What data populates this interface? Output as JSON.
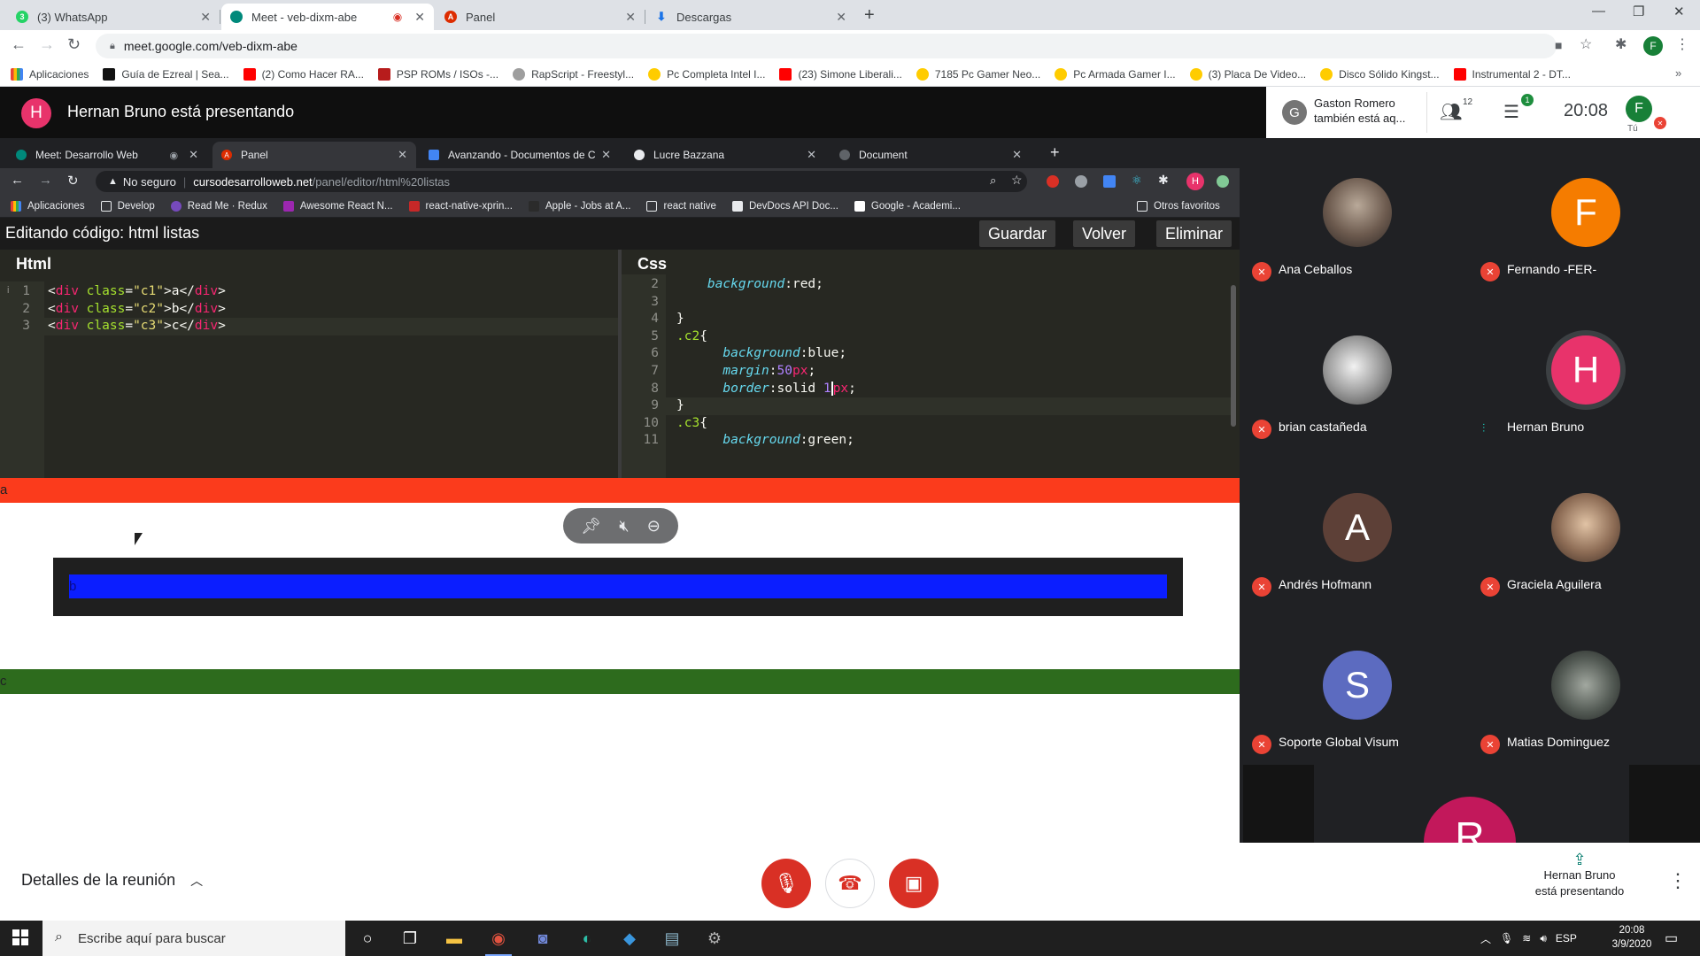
{
  "outer_browser": {
    "tabs": [
      {
        "title": "(3) WhatsApp",
        "color": "#25d366",
        "glyph": "3"
      },
      {
        "title": "Meet - veb-dixm-abe",
        "color": "#00897b",
        "glyph": ""
      },
      {
        "title": "Panel",
        "color": "#dd2c00",
        "glyph": "A"
      },
      {
        "title": "Descargas",
        "color": "#1a73e8",
        "glyph": "⬇"
      }
    ],
    "url": "meet.google.com/veb-dixm-abe",
    "bookmarks": [
      "Aplicaciones",
      "Guía de Ezreal | Sea...",
      "(2) Como Hacer RA...",
      "PSP ROMs / ISOs -...",
      "RapScript - Freestyl...",
      "Pc Completa Intel I...",
      "(23) Simone Liberali...",
      "7185 Pc Gamer Neo...",
      "Pc Armada Gamer I...",
      "(3) Placa De Video...",
      "Disco Sólido Kingst...",
      "Instrumental 2 - DT..."
    ],
    "profile_initial": "F"
  },
  "meet": {
    "presenter_initial": "H",
    "presenting_title": "Hernan Bruno está presentando",
    "also_presenting": {
      "initial": "G",
      "line1": "Gaston Romero",
      "line2": "también está aq..."
    },
    "people_count": "12",
    "chat_badge": "1",
    "time": "20:08",
    "self_initial": "F",
    "self_label": "Tú",
    "meeting_details": "Detalles de la reunión",
    "presenting_info_line1": "Hernan Bruno",
    "presenting_info_line2": "está presentando"
  },
  "inner_browser": {
    "tabs": [
      "Meet: Desarrollo Web",
      "Panel",
      "Avanzando - Documentos de C",
      "Lucre Bazzana",
      "Document"
    ],
    "not_secure": "No seguro",
    "host": "cursodesarrolloweb.net",
    "path": "/panel/editor/html%20listas",
    "profile_initial": "H",
    "bookmarks": [
      "Aplicaciones",
      "Develop",
      "Read Me · Redux",
      "Awesome React N...",
      "react-native-xprin...",
      "Apple - Jobs at A...",
      "react native",
      "DevDocs API Doc...",
      "Google - Academi...",
      "Otros favoritos"
    ]
  },
  "editor": {
    "title": "Editando código: html listas",
    "btn_save": "Guardar",
    "btn_back": "Volver",
    "btn_delete": "Eliminar",
    "html_title": "Html",
    "css_title": "Css",
    "html_line_numbers": [
      "1",
      "2",
      "3"
    ],
    "css_line_numbers": [
      "2",
      "3",
      "4",
      "5",
      "6",
      "7",
      "8",
      "9",
      "10",
      "11"
    ]
  },
  "render": {
    "letter_a": "a",
    "letter_b": "b",
    "letter_c": "c"
  },
  "participants": [
    {
      "name": "Ana Ceballos",
      "initial": "",
      "color": "",
      "muted": true,
      "photo": "photo"
    },
    {
      "name": "Fernando -FER-",
      "initial": "F",
      "color": "#f57c00",
      "muted": true,
      "photo": ""
    },
    {
      "name": "brian castañeda",
      "initial": "",
      "color": "",
      "muted": true,
      "photo": "photo2"
    },
    {
      "name": "Hernan Bruno",
      "initial": "H",
      "color": "#e8336b",
      "muted": false,
      "photo": ""
    },
    {
      "name": "Andrés Hofmann",
      "initial": "A",
      "color": "#5d4037",
      "muted": true,
      "photo": ""
    },
    {
      "name": "Graciela Aguilera",
      "initial": "",
      "color": "",
      "muted": true,
      "photo": "photo3"
    },
    {
      "name": "Soporte Global Visum",
      "initial": "S",
      "color": "#5c6bc0",
      "muted": true,
      "photo": ""
    },
    {
      "name": "Matias Dominguez",
      "initial": "",
      "color": "",
      "muted": true,
      "photo": "photo4"
    }
  ],
  "partial_participant_initial": "R",
  "taskbar": {
    "search_placeholder": "Escribe aquí para buscar",
    "lang": "ESP",
    "time": "20:08",
    "date": "3/9/2020"
  }
}
